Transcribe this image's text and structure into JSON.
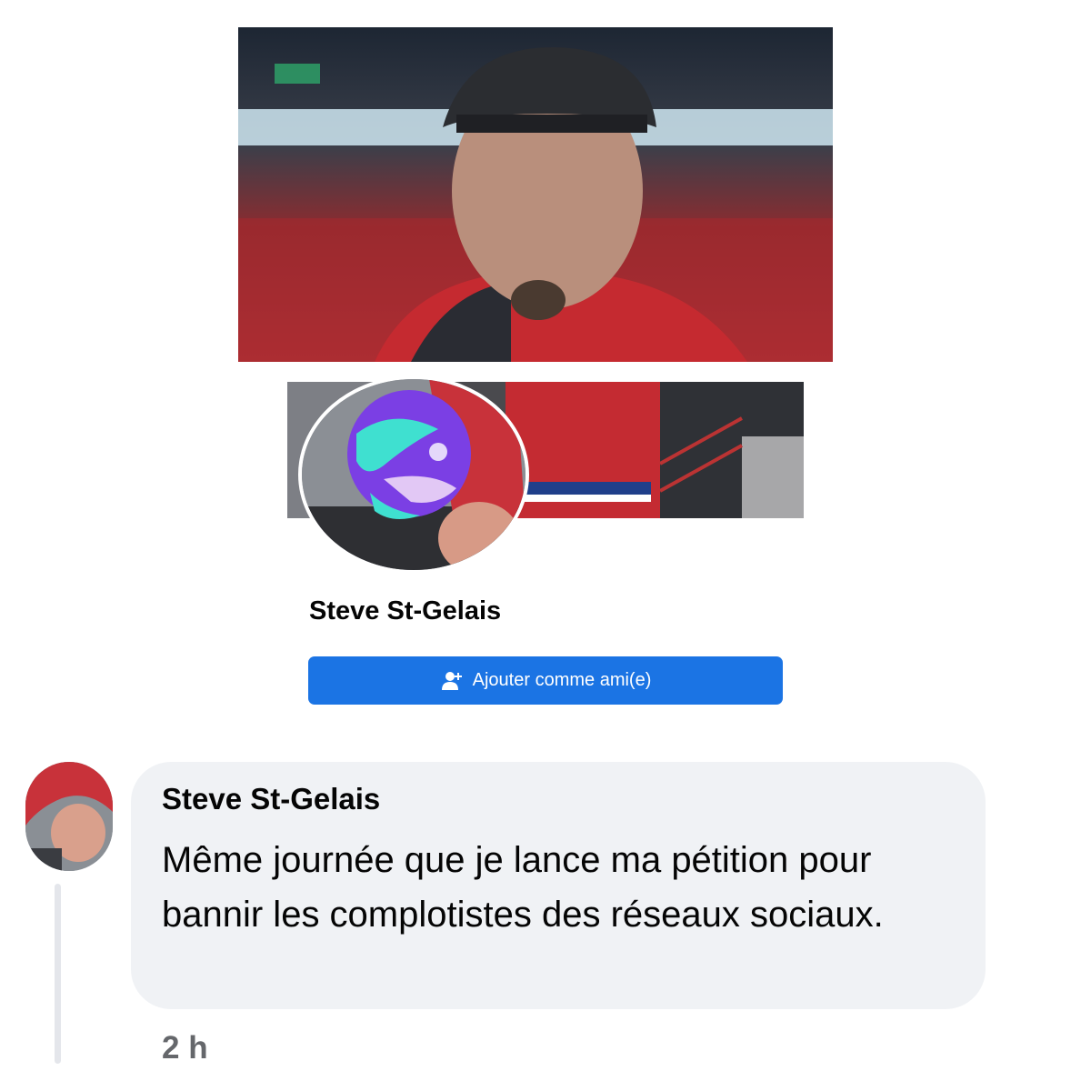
{
  "profile": {
    "name": "Steve St-Gelais",
    "add_friend_label": "Ajouter comme ami(e)",
    "add_friend_icon": "add-friend-icon"
  },
  "comment": {
    "author": "Steve St-Gelais",
    "text": "Même journée que je lance ma pétition pour bannir les complotistes des réseaux sociaux.",
    "time": "2 h"
  },
  "colors": {
    "button_blue": "#1b74e4",
    "bubble_bg": "#f0f2f5",
    "meta_gray": "#65676b"
  }
}
